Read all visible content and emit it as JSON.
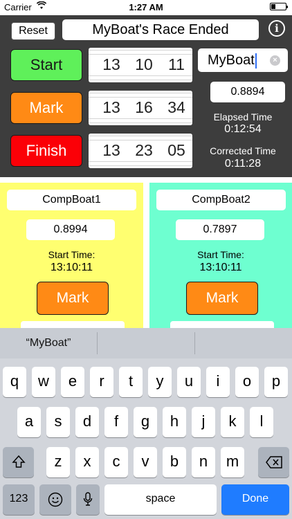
{
  "status_bar": {
    "carrier": "Carrier",
    "time": "1:27 AM"
  },
  "header": {
    "reset_label": "Reset",
    "title": "MyBoat's Race Ended",
    "info_icon": "i"
  },
  "race": {
    "start_label": "Start",
    "mark_label": "Mark",
    "finish_label": "Finish",
    "start_time": [
      "13",
      "10",
      "11"
    ],
    "mark_time": [
      "13",
      "16",
      "34"
    ],
    "finish_time": [
      "13",
      "23",
      "05"
    ],
    "boat_name": "MyBoat",
    "handicap": "0.8894",
    "elapsed_label": "Elapsed Time",
    "elapsed_value": "0:12:54",
    "corrected_label": "Corrected Time",
    "corrected_value": "0:11:28"
  },
  "competitors": [
    {
      "name": "CompBoat1",
      "handicap": "0.8994",
      "start_label": "Start Time:",
      "start_value": "13:10:11",
      "mark_label": "Mark",
      "color": "#ffff70"
    },
    {
      "name": "CompBoat2",
      "handicap": "0.7897",
      "start_label": "Start Time:",
      "start_value": "13:10:11",
      "mark_label": "Mark",
      "color": "#6effd0"
    }
  ],
  "keyboard": {
    "suggestions": [
      "“MyBoat”",
      "",
      ""
    ],
    "row1": [
      "q",
      "w",
      "e",
      "r",
      "t",
      "y",
      "u",
      "i",
      "o",
      "p"
    ],
    "row2": [
      "a",
      "s",
      "d",
      "f",
      "g",
      "h",
      "j",
      "k",
      "l"
    ],
    "row3": [
      "z",
      "x",
      "c",
      "v",
      "b",
      "n",
      "m"
    ],
    "num_label": "123",
    "space_label": "space",
    "done_label": "Done",
    "icons": {
      "shift": "shift-icon",
      "backspace": "backspace-icon",
      "emoji": "emoji-icon",
      "mic": "microphone-icon"
    }
  }
}
